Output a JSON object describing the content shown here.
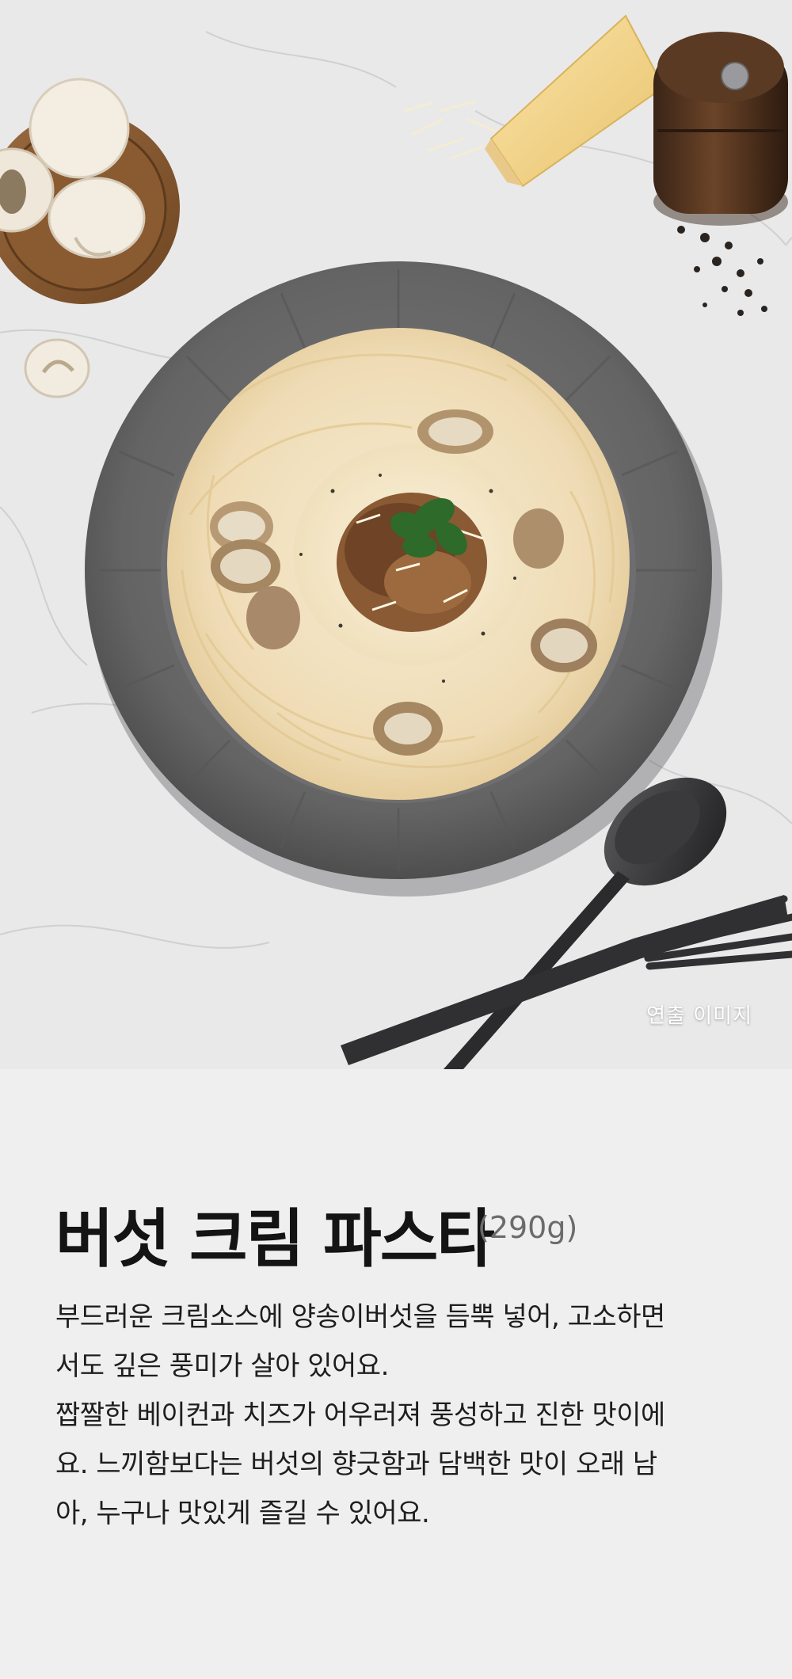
{
  "hero": {
    "caption": "연출 이미지"
  },
  "product": {
    "name": "버섯 크림 파스타",
    "weight": "(290g)",
    "description_lines": [
      "부드러운 크림소스에 양송이버섯을 듬뿍 넣어, 고소하면",
      "서도 깊은 풍미가 살아 있어요.",
      "짭짤한 베이컨과 치즈가 어우러져 풍성하고 진한 맛이에",
      "요. 느끼함보다는 버섯의 향긋함과 담백한 맛이 오래 남",
      "아, 누구나 맛있게 즐길 수 있어요."
    ]
  },
  "colors": {
    "marble": "#e9e9ea",
    "plate": "#6b6b6b",
    "pasta": "#f1dfbd",
    "info_background": "#efefef",
    "title": "#141414",
    "weight": "#6b6b6b"
  }
}
